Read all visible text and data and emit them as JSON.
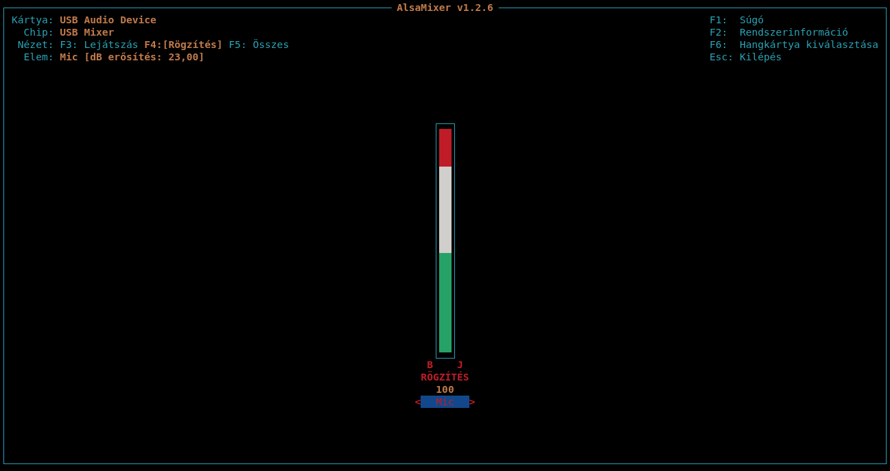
{
  "window": {
    "title": "AlsaMixer v1.2.6"
  },
  "info": [
    {
      "kind": "value",
      "label": "Kártya:",
      "value": "USB Audio Device"
    },
    {
      "kind": "value",
      "label": "Chip:",
      "value": "USB Mixer"
    },
    {
      "kind": "view",
      "label": "Nézet:",
      "options": [
        {
          "text": "F3: Lejátszás",
          "selected": false
        },
        {
          "text": "F4:[Rögzítés]",
          "selected": true
        },
        {
          "text": "F5: Összes",
          "selected": false
        }
      ]
    },
    {
      "kind": "value",
      "label": "Elem:",
      "value": "Mic [dB erősítés: 23,00]"
    }
  ],
  "help": [
    {
      "key": "F1:",
      "action": "Súgó"
    },
    {
      "key": "F2:",
      "action": "Rendszerinformáció"
    },
    {
      "key": "F6:",
      "action": "Hangkártya kiválasztása"
    },
    {
      "key": "Esc:",
      "action": "Kilépés"
    }
  ],
  "control": {
    "name": "Mic",
    "selected": true,
    "level": 1.0,
    "channels": [
      "B",
      "J"
    ],
    "capture": true,
    "capture_label": "RÖGZÍTÉS",
    "value": "100",
    "prev": "<",
    "next": ">"
  }
}
